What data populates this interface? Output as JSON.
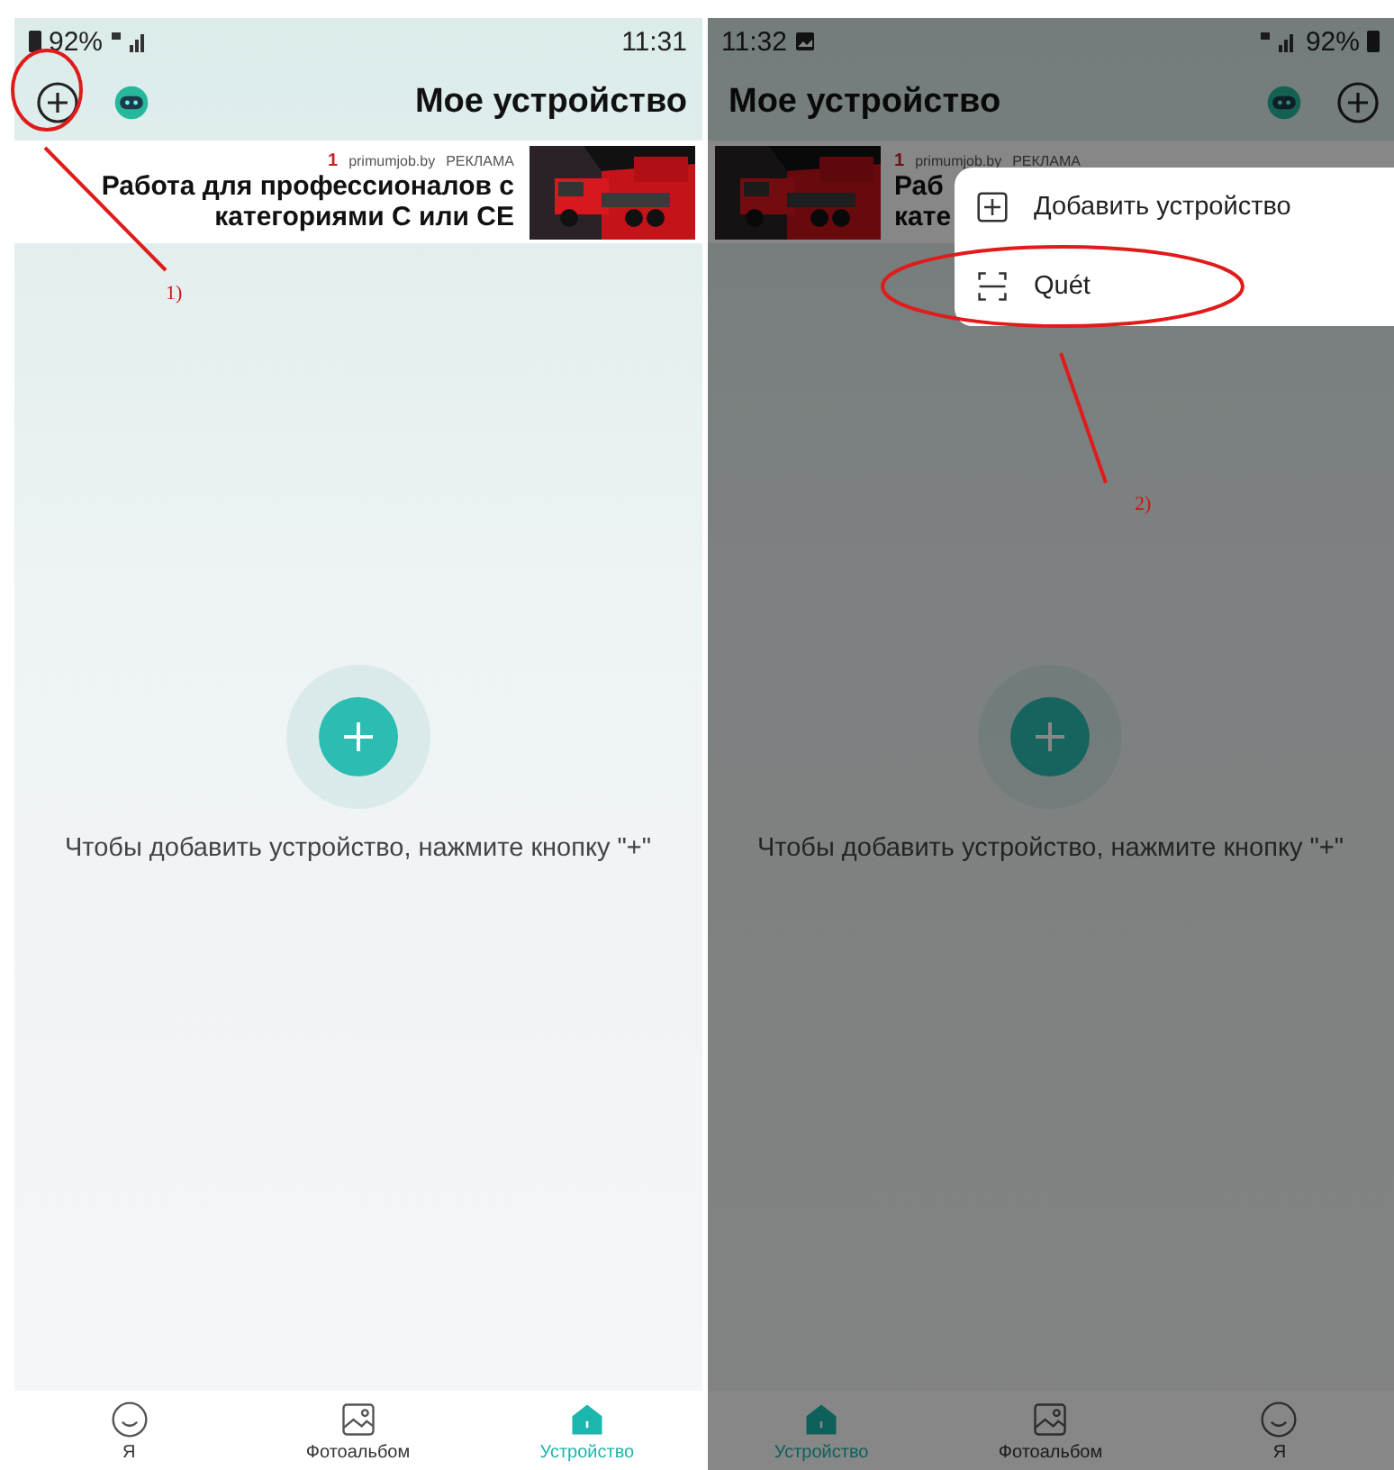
{
  "panels": [
    {
      "mirrored": true,
      "dimmed": false,
      "status_bar": {
        "time": "11:31",
        "battery": "92%"
      },
      "title": "Мое устройство",
      "ad": {
        "badge": "1",
        "domain": "primumjob.by",
        "label": "РЕКЛАМА",
        "lines": [
          "Работа для профессионалов с",
          "категориями С или CE"
        ]
      },
      "empty_hint": "Чтобы добавить устройство, нажмите кнопку \"+\"",
      "nav": [
        {
          "kind": "profile",
          "label": "Я",
          "selected": false
        },
        {
          "kind": "album",
          "label": "Фотоальбом",
          "selected": false
        },
        {
          "kind": "home",
          "label": "Устройство",
          "selected": true
        }
      ]
    },
    {
      "mirrored": false,
      "dimmed": true,
      "status_bar": {
        "time": "11:32",
        "battery": "92%"
      },
      "title": "Мое устройство",
      "ad": {
        "badge": "1",
        "domain": "primumjob.by",
        "label": "РЕКЛАМА",
        "lines": [
          "Раб",
          "кате"
        ]
      },
      "empty_hint": "Чтобы добавить устройство, нажмите кнопку \"+\"",
      "nav": [
        {
          "kind": "home",
          "label": "Устройство",
          "selected": true
        },
        {
          "kind": "album",
          "label": "Фотоальбом",
          "selected": false
        },
        {
          "kind": "profile",
          "label": "Я",
          "selected": false
        }
      ],
      "menu": [
        {
          "kind": "add",
          "label": "Добавить устройство"
        },
        {
          "kind": "scan",
          "label": "Quét"
        }
      ]
    }
  ],
  "annotations": [
    {
      "label": "1)"
    },
    {
      "label": "2)"
    }
  ]
}
